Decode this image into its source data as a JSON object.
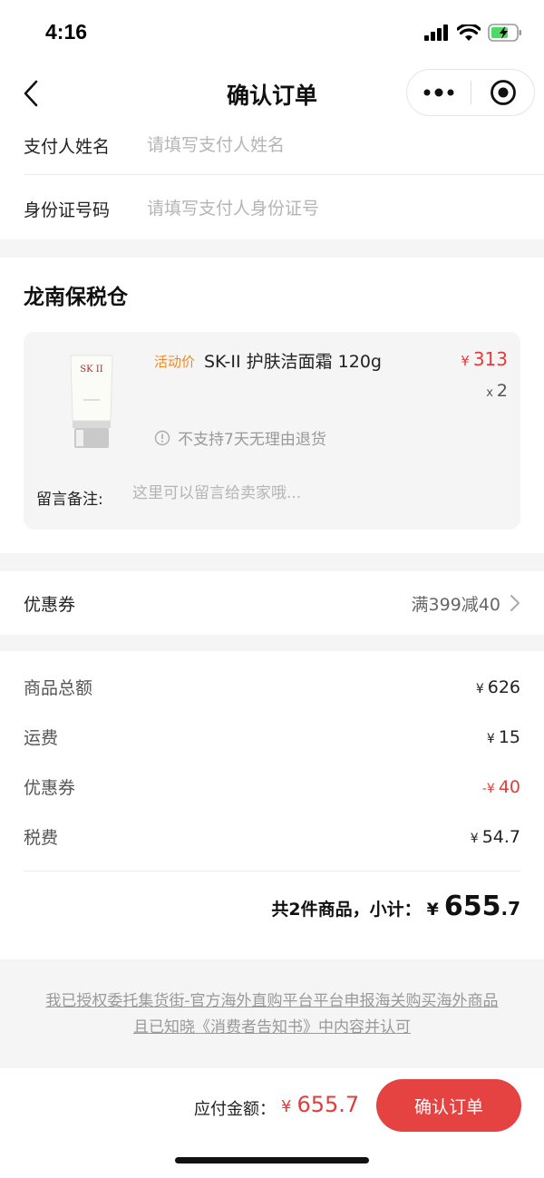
{
  "status": {
    "time": "4:16"
  },
  "nav": {
    "title": "确认订单"
  },
  "payer": {
    "name_label": "支付人姓名",
    "name_placeholder": "请填写支付人姓名",
    "id_label": "身份证号码",
    "id_placeholder": "请填写支付人身份证号"
  },
  "order": {
    "warehouse": "龙南保税仓",
    "product": {
      "promo_tag": "活动价",
      "name": "SK-II 护肤洁面霜 120g",
      "currency": "¥",
      "price": "313",
      "qty_prefix": "x",
      "qty": "2",
      "return_note": "不支持7天无理由退货",
      "image_icon": "sk2-cleanser-tube"
    },
    "remark_label": "留言备注:",
    "remark_placeholder": "这里可以留言给卖家哦..."
  },
  "coupon": {
    "label": "优惠券",
    "value": "满399减40"
  },
  "summary": {
    "currency": "¥",
    "rows": [
      {
        "label": "商品总额",
        "value": "626"
      },
      {
        "label": "运费",
        "value": "15"
      },
      {
        "label": "优惠券",
        "value": "40",
        "prefix": "-"
      },
      {
        "label": "税费",
        "value": "54.7"
      }
    ],
    "subtotal_label": "共2件商品，小计：",
    "subtotal_int": "655",
    "subtotal_dec": ".7"
  },
  "agreement": {
    "line1": "我已授权委托集货街-官方海外直购平台平台申报海关购买海外商品",
    "line2": "且已知晓《消费者告知书》中内容并认可"
  },
  "footer": {
    "pay_label": "应付金额：",
    "currency": "¥",
    "pay_amount": "655.7",
    "confirm_label": "确认订单"
  },
  "colors": {
    "accent_red": "#e54242",
    "promo_orange": "#f08a24"
  }
}
